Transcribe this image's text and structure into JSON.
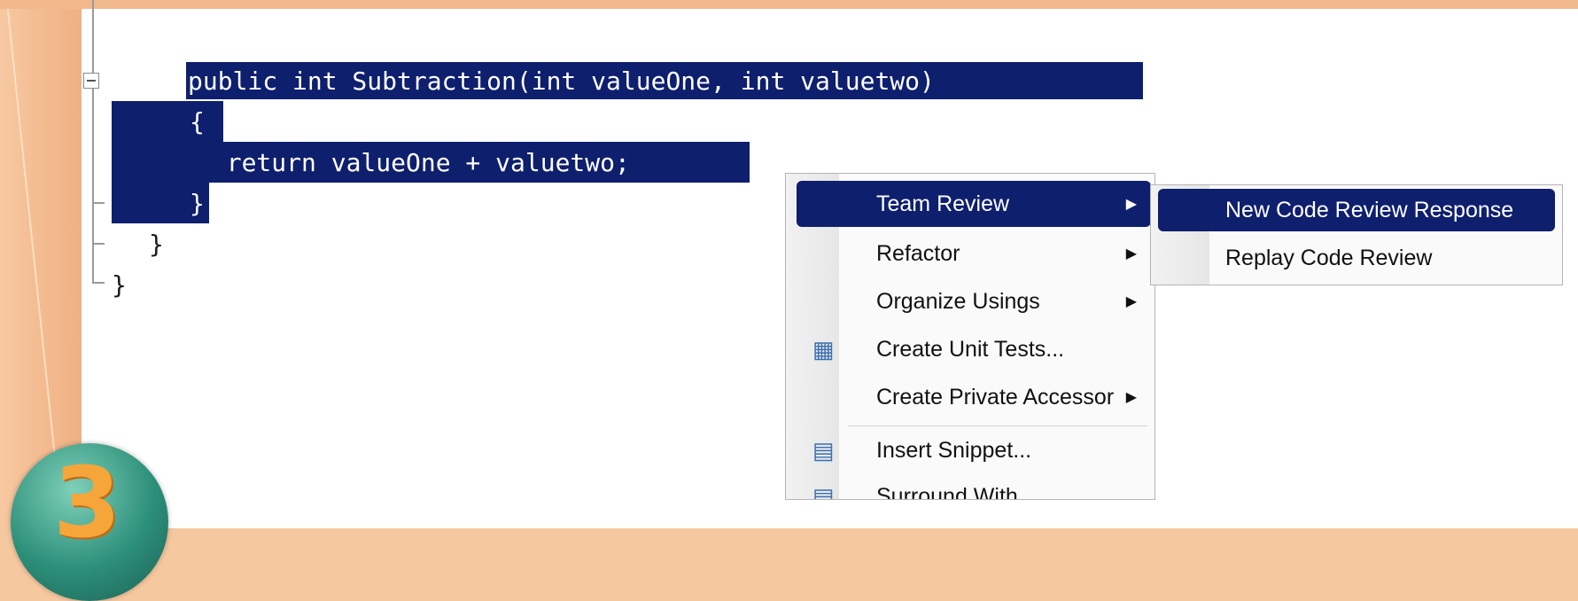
{
  "code": {
    "line_signature": "public int Subtraction(int valueOne, int valuetwo)",
    "line_open_brace": "{",
    "line_return": "  return valueOne + valuetwo;",
    "line_close_brace": "}",
    "line_class_close": "}",
    "line_namespace_close": "}",
    "selection_color": "#0e1f6e"
  },
  "context_menu": {
    "items": [
      {
        "label": "Team Review",
        "has_submenu": true,
        "highlighted": true
      },
      {
        "label": "Refactor",
        "has_submenu": true
      },
      {
        "label": "Organize Usings",
        "has_submenu": true
      },
      {
        "label": "Create Unit Tests...",
        "icon": "unit-test-icon"
      },
      {
        "label": "Create Private Accessor",
        "has_submenu": true
      },
      {
        "label": "Insert Snippet...",
        "icon": "snippet-icon"
      },
      {
        "label": "Surround With...",
        "icon": "surround-icon"
      }
    ]
  },
  "submenu": {
    "items": [
      {
        "label": "New Code Review Response",
        "highlighted": true
      },
      {
        "label": "Replay Code Review"
      }
    ]
  },
  "badge": {
    "number": "3",
    "color": "#f6a53a"
  }
}
